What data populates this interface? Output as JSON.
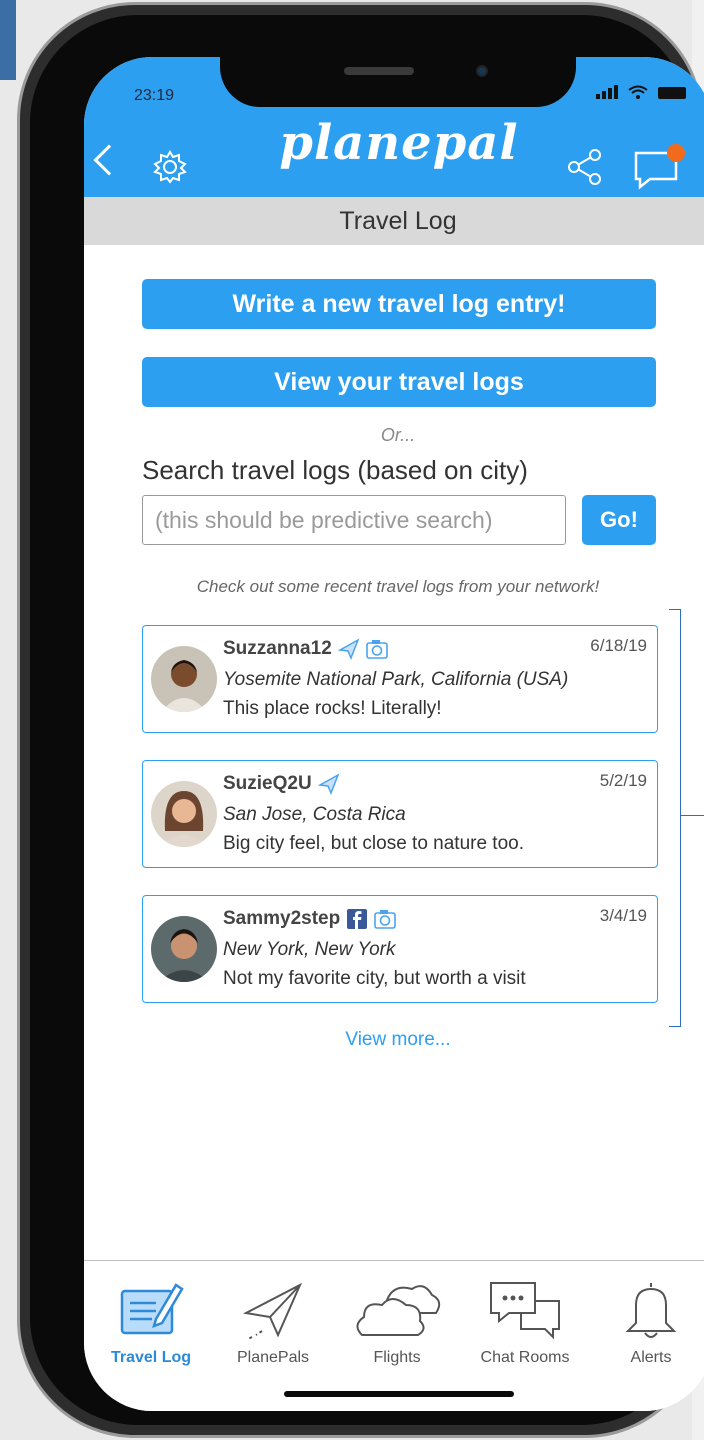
{
  "status": {
    "time": "23:19"
  },
  "header": {
    "logo": "planepal",
    "section_title": "Travel Log"
  },
  "actions": {
    "write_label": "Write a new travel log entry!",
    "view_label": "View your travel logs",
    "or_text": "Or...",
    "search_label": "Search travel logs (based on city)",
    "search_placeholder": "(this should be predictive search)",
    "go_label": "Go!"
  },
  "feed": {
    "note": "Check out some recent travel logs from your network!",
    "entries": [
      {
        "user": "Suzzanna12",
        "date": "6/18/19",
        "location": "Yosemite National Park, California (USA)",
        "message": "This place rocks!  Literally!",
        "icons": [
          "plane-icon",
          "camera-icon"
        ]
      },
      {
        "user": "SuzieQ2U",
        "date": "5/2/19",
        "location": "San Jose, Costa Rica",
        "message": "Big city feel, but close to nature too.",
        "icons": [
          "plane-icon"
        ]
      },
      {
        "user": "Sammy2step",
        "date": "3/4/19",
        "location": "New York, New York",
        "message": "Not my favorite city, but worth a visit",
        "icons": [
          "facebook-icon",
          "camera-icon"
        ]
      }
    ],
    "view_more": "View more..."
  },
  "tabs": [
    {
      "label": "Travel Log",
      "icon": "notepad-pencil-icon",
      "active": true
    },
    {
      "label": "PlanePals",
      "icon": "paper-plane-icon",
      "active": false
    },
    {
      "label": "Flights",
      "icon": "cloud-icon",
      "active": false
    },
    {
      "label": "Chat Rooms",
      "icon": "chat-bubbles-icon",
      "active": false
    },
    {
      "label": "Alerts",
      "icon": "bell-icon",
      "active": false
    }
  ],
  "colors": {
    "accent": "#2d9ff0",
    "section_bar": "#d9d9d9",
    "notification_dot": "#f26b1d"
  }
}
